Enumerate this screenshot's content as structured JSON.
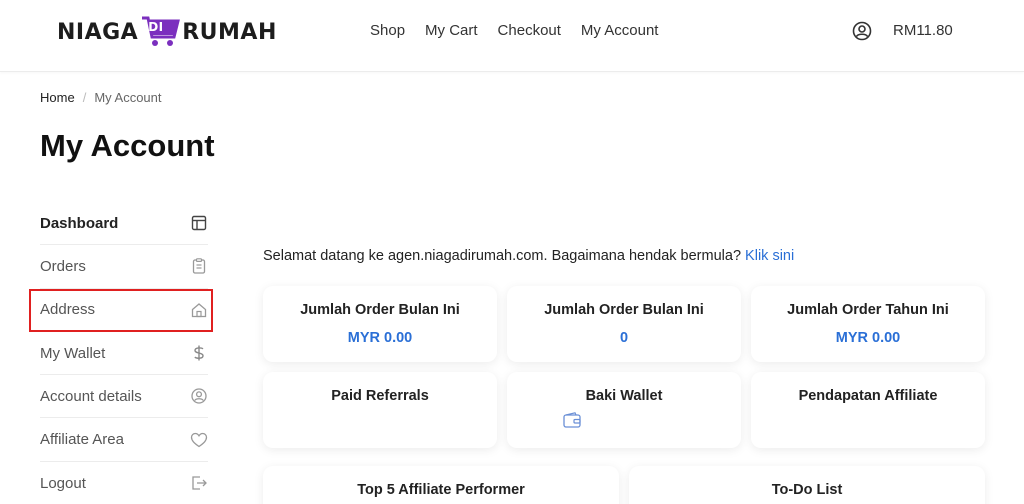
{
  "header": {
    "logo_text_left": "NIAGA",
    "logo_badge": "DI",
    "logo_text_right": "RUMAH",
    "nav": [
      "Shop",
      "My Cart",
      "Checkout",
      "My Account"
    ],
    "cart_total": "RM11.80",
    "user_icon": "user-circle-icon"
  },
  "breadcrumb": {
    "home": "Home",
    "separator": "/",
    "current": "My Account"
  },
  "page_title": "My Account",
  "sidebar": {
    "items": [
      {
        "label": "Dashboard",
        "icon": "layout-icon",
        "active": true
      },
      {
        "label": "Orders",
        "icon": "clipboard-icon",
        "active": false
      },
      {
        "label": "Address",
        "icon": "home-icon",
        "active": false,
        "highlighted": true
      },
      {
        "label": "My Wallet",
        "icon": "dollar-icon",
        "active": false
      },
      {
        "label": "Account details",
        "icon": "user-circle-icon",
        "active": false
      },
      {
        "label": "Affiliate Area",
        "icon": "heart-icon",
        "active": false
      },
      {
        "label": "Logout",
        "icon": "logout-icon",
        "active": false
      }
    ]
  },
  "welcome": {
    "text": "Selamat datang ke agen.niagadirumah.com. Bagaimana hendak bermula?",
    "link": "Klik sini"
  },
  "cards": [
    {
      "title": "Jumlah Order Bulan Ini",
      "value": "MYR 0.00"
    },
    {
      "title": "Jumlah Order Bulan Ini",
      "value": "0"
    },
    {
      "title": "Jumlah Order Tahun Ini",
      "value": "MYR 0.00"
    },
    {
      "title": "Paid Referrals",
      "value": ""
    },
    {
      "title": "Baki Wallet",
      "value": ""
    },
    {
      "title": "Pendapatan Affiliate",
      "value": ""
    },
    {
      "title": "Top 5 Affiliate Performer",
      "value": ""
    },
    {
      "title": "To-Do List",
      "value": ""
    }
  ],
  "colors": {
    "accent": "#2a6fd6",
    "highlight": "#e02020",
    "logo_purple": "#7b2fbe"
  }
}
